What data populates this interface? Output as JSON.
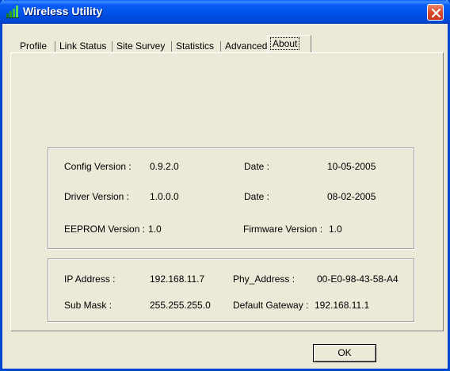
{
  "window": {
    "title": "Wireless Utility"
  },
  "tabs": [
    {
      "label": "Profile"
    },
    {
      "label": "Link Status"
    },
    {
      "label": "Site Survey"
    },
    {
      "label": "Statistics"
    },
    {
      "label": "Advanced"
    },
    {
      "label": "About",
      "active": true
    }
  ],
  "versions": {
    "config_label": "Config Version :",
    "config_value": "0.9.2.0",
    "config_date_label": "Date :",
    "config_date_value": "10-05-2005",
    "driver_label": "Driver Version :",
    "driver_value": "1.0.0.0",
    "driver_date_label": "Date :",
    "driver_date_value": "08-02-2005",
    "eeprom_label": "EEPROM Version :",
    "eeprom_value": "1.0",
    "firmware_label": "Firmware Version :",
    "firmware_value": "1.0"
  },
  "network": {
    "ip_label": "IP Address :",
    "ip_value": "192.168.11.7",
    "phy_label": "Phy_Address :",
    "phy_value": "00-E0-98-43-58-A4",
    "mask_label": "Sub Mask :",
    "mask_value": "255.255.255.0",
    "gateway_label": "Default Gateway :",
    "gateway_value": "192.168.11.1"
  },
  "buttons": {
    "ok_label": "OK"
  },
  "colors": {
    "titlebar": "#0050e6",
    "face": "#ece9d8",
    "close": "#d8492b"
  },
  "icons": {
    "app": "signal-bars-icon",
    "close": "close-icon"
  }
}
